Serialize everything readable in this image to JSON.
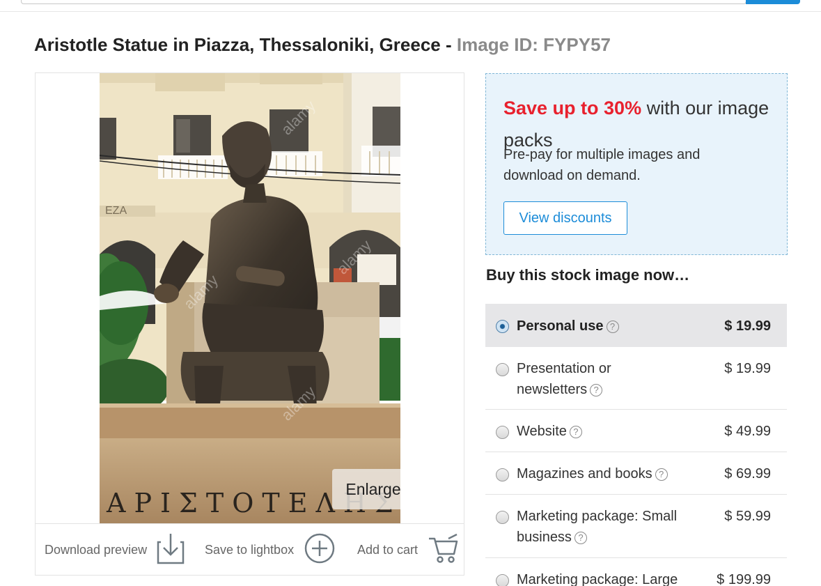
{
  "title": {
    "main": "Aristotle Statue in Piazza, Thessaloniki, Greece",
    "separator": "-",
    "image_id": "Image ID: FYPY57"
  },
  "image": {
    "watermark": "alamy",
    "pedestal_inscription": "ΑΡΙΣΤΟΤΕΛΗΣ",
    "building_sign": "EZA",
    "enlarge_label": "Enlarge"
  },
  "actions": {
    "download_preview": "Download preview",
    "save_to_lightbox": "Save to lightbox",
    "add_to_cart": "Add to cart"
  },
  "promo": {
    "highlight": "Save up to 30%",
    "headline_rest": " with our image packs",
    "text": "Pre-pay for multiple images and download on demand.",
    "button": "View discounts"
  },
  "buy_heading": "Buy this stock image now…",
  "license_options": [
    {
      "label": "Personal use",
      "price": "$ 19.99",
      "selected": true
    },
    {
      "label": "Presentation or newsletters",
      "price": "$ 19.99",
      "selected": false
    },
    {
      "label": "Website",
      "price": "$ 49.99",
      "selected": false
    },
    {
      "label": "Magazines and books",
      "price": "$ 69.99",
      "selected": false
    },
    {
      "label": "Marketing package: Small business",
      "price": "$ 59.99",
      "selected": false
    },
    {
      "label": "Marketing package: Large",
      "price": "$ 199.99",
      "selected": false
    }
  ],
  "colors": {
    "accent_blue": "#1c8cd8",
    "promo_red": "#e8212e",
    "promo_bg": "#e8f3fb"
  }
}
